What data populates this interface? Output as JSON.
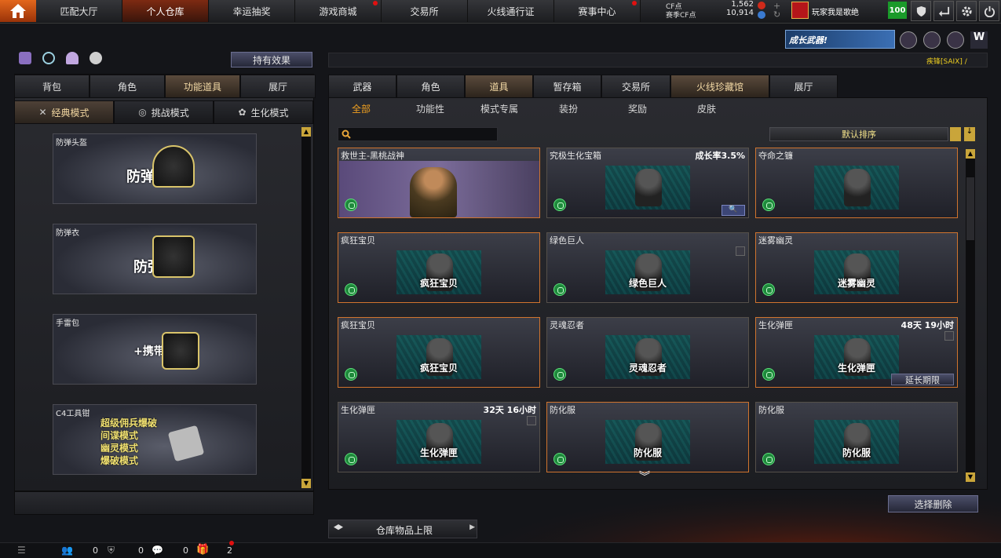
{
  "nav": {
    "items": [
      {
        "label": "匹配大厅",
        "active": false,
        "dot": false
      },
      {
        "label": "个人仓库",
        "active": true,
        "dot": false
      },
      {
        "label": "幸运抽奖",
        "active": false,
        "dot": false
      },
      {
        "label": "游戏商城",
        "active": false,
        "dot": true
      },
      {
        "label": "交易所",
        "active": false,
        "dot": false
      },
      {
        "label": "火线通行证",
        "active": false,
        "dot": false
      },
      {
        "label": "赛事中心",
        "active": false,
        "dot": true
      }
    ],
    "cf_label": "CF点",
    "cf_value": "1,562",
    "cfs_label": "赛季CF点",
    "cfs_value": "10,914",
    "user": "玩家我是歌绝",
    "level": "100"
  },
  "banner": {
    "text": "成长武器!",
    "marquee": "疾锋[SAIX] /"
  },
  "left": {
    "effect_button": "持有效果",
    "tabs": [
      "背包",
      "角色",
      "功能道具",
      "展厅"
    ],
    "active_tab": 2,
    "modes": [
      "经典模式",
      "挑战模式",
      "生化模式"
    ],
    "cards": [
      {
        "name": "防弹头盔",
        "big": "防弹头盔"
      },
      {
        "name": "防弹衣",
        "big": "防弹衣"
      },
      {
        "name": "手雷包",
        "big": "+携带数"
      },
      {
        "name": "C4工具钳",
        "lines": [
          "超级佣兵爆破",
          "间谍模式",
          "幽灵模式",
          "爆破模式"
        ]
      }
    ]
  },
  "right": {
    "tabs": [
      "武器",
      "角色",
      "道具",
      "暂存箱",
      "交易所",
      "火线珍藏馆",
      "展厅"
    ],
    "active_tab": 2,
    "subtabs": [
      "全部",
      "功能性",
      "模式专属",
      "装扮",
      "奖励",
      "皮肤"
    ],
    "active_sub": 0,
    "search_placeholder": "",
    "sort_label": "默认排序",
    "items": [
      {
        "name": "救世主-黑桃战神",
        "time": "",
        "thumb": "",
        "sel": true
      },
      {
        "name": "究极生化宝箱",
        "time": "成长率3.5%",
        "thumb": "",
        "sel": false,
        "search": true
      },
      {
        "name": "夺命之镰",
        "time": "",
        "thumb": "",
        "sel": true
      },
      {
        "name": "疯狂宝贝",
        "time": "",
        "thumb": "疯狂宝贝",
        "sel": true
      },
      {
        "name": "绿色巨人",
        "time": "",
        "thumb": "绿色巨人",
        "sel": false,
        "lock": true
      },
      {
        "name": "迷雾幽灵",
        "time": "",
        "thumb": "迷雾幽灵",
        "sel": true
      },
      {
        "name": "疯狂宝贝",
        "time": "",
        "thumb": "疯狂宝贝",
        "sel": true
      },
      {
        "name": "灵魂忍者",
        "time": "",
        "thumb": "灵魂忍者",
        "sel": false
      },
      {
        "name": "生化弹匣",
        "time": "48天 19小时",
        "thumb": "生化弹匣",
        "sel": true,
        "lock": true,
        "extend": "延长期限"
      },
      {
        "name": "生化弹匣",
        "time": "32天 16小时",
        "thumb": "生化弹匣",
        "sel": false,
        "lock": true
      },
      {
        "name": "防化服",
        "time": "",
        "thumb": "防化服",
        "sel": true
      },
      {
        "name": "防化服",
        "time": "",
        "thumb": "防化服",
        "sel": false
      }
    ],
    "delete_button": "选择删除",
    "capacity_label": "仓库物品上限"
  },
  "status": {
    "counts": [
      "0",
      "0",
      "0",
      "2"
    ]
  }
}
